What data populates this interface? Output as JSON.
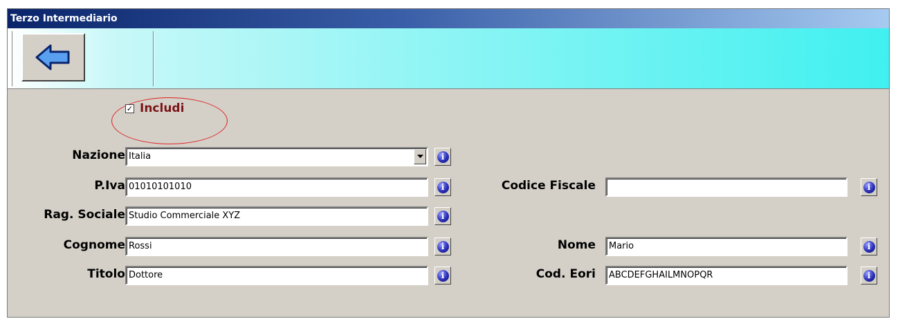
{
  "window": {
    "title": "Terzo Intermediario"
  },
  "toolbar": {
    "back_icon": "back-arrow-icon"
  },
  "include": {
    "label": "Includi",
    "checked": true,
    "check_mark": "✓"
  },
  "form": {
    "nazione": {
      "label": "Nazione",
      "value": "Italia"
    },
    "piva": {
      "label": "P.Iva",
      "value": "01010101010"
    },
    "codice_fiscale": {
      "label": "Codice Fiscale",
      "value": ""
    },
    "rag_sociale": {
      "label": "Rag. Sociale",
      "value": "Studio Commerciale XYZ"
    },
    "cognome": {
      "label": "Cognome",
      "value": "Rossi"
    },
    "nome": {
      "label": "Nome",
      "value": "Mario"
    },
    "titolo": {
      "label": "Titolo",
      "value": "Dottore"
    },
    "cod_eori": {
      "label": "Cod. Eori",
      "value": "ABCDEFGHAILMNOPQR"
    }
  },
  "info_button": {
    "glyph": "i"
  },
  "colors": {
    "include_label": "#7b1416",
    "highlight_ellipse": "#e02020",
    "toolbar_accent": "#40f0f0",
    "title_bar": "#0a246a"
  }
}
